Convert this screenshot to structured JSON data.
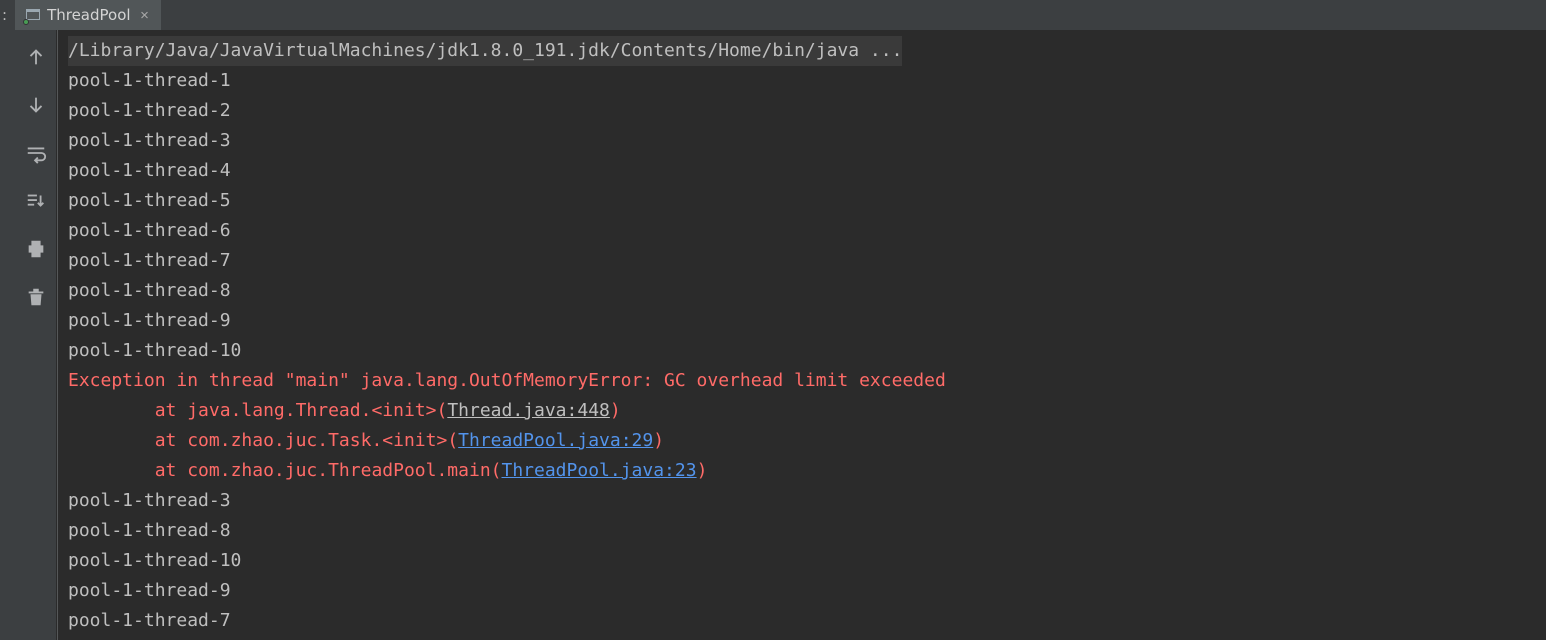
{
  "tabbar": {
    "left_label_fragment": ":",
    "tab": {
      "title": "ThreadPool",
      "close_glyph": "×"
    }
  },
  "toolbar": {
    "up": "scroll-to-top",
    "down": "scroll-to-end",
    "wrap": "soft-wrap",
    "scroll_end": "scroll-to-end-on-output",
    "print": "print",
    "trash": "clear-all"
  },
  "console": {
    "command": "/Library/Java/JavaVirtualMachines/jdk1.8.0_191.jdk/Contents/Home/bin/java ...",
    "pre_lines": [
      "pool-1-thread-1",
      "pool-1-thread-2",
      "pool-1-thread-3",
      "pool-1-thread-4",
      "pool-1-thread-5",
      "pool-1-thread-6",
      "pool-1-thread-7",
      "pool-1-thread-8",
      "pool-1-thread-9",
      "pool-1-thread-10"
    ],
    "exception": {
      "header": "Exception in thread \"main\" java.lang.OutOfMemoryError: GC overhead limit exceeded",
      "frames": [
        {
          "indent": "\tat ",
          "text": "java.lang.Thread.<init>",
          "open": "(",
          "link": "Thread.java:448",
          "link_style": "muted",
          "close": ")"
        },
        {
          "indent": "\tat ",
          "text": "com.zhao.juc.Task.<init>",
          "open": "(",
          "link": "ThreadPool.java:29",
          "link_style": "blue",
          "close": ")"
        },
        {
          "indent": "\tat ",
          "text": "com.zhao.juc.ThreadPool.main",
          "open": "(",
          "link": "ThreadPool.java:23",
          "link_style": "blue",
          "close": ")"
        }
      ]
    },
    "post_lines": [
      "pool-1-thread-3",
      "pool-1-thread-8",
      "pool-1-thread-10",
      "pool-1-thread-9",
      "pool-1-thread-7"
    ]
  }
}
